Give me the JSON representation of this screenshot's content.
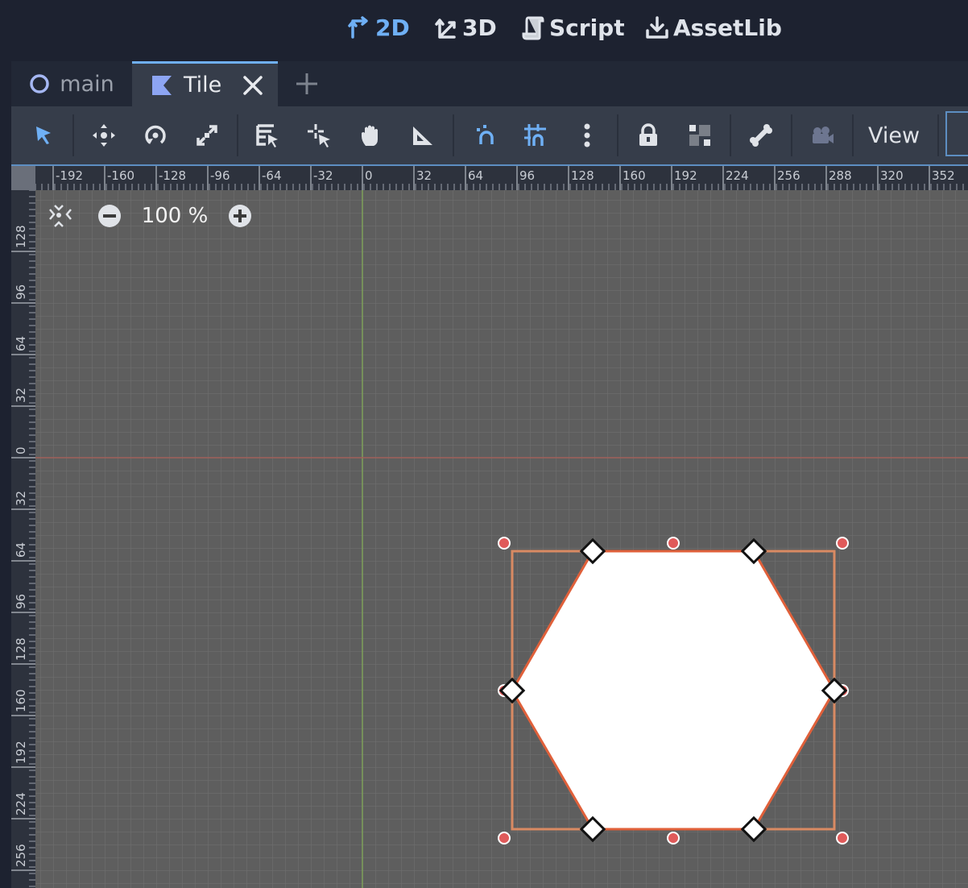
{
  "workspaces": [
    {
      "label": "2D",
      "icon": "2d-workspace-icon",
      "active": true
    },
    {
      "label": "3D",
      "icon": "3d-workspace-icon",
      "active": false
    },
    {
      "label": "Script",
      "icon": "script-workspace-icon",
      "active": false
    },
    {
      "label": "AssetLib",
      "icon": "assetlib-download-icon",
      "active": false
    }
  ],
  "tabs": [
    {
      "label": "main",
      "icon": "node2d-circle-icon",
      "active": false
    },
    {
      "label": "Tile",
      "icon": "tile-scene-icon",
      "active": true,
      "close_icon": "close-icon"
    }
  ],
  "new_tab_icon": "plus-icon",
  "toolbar": {
    "tools": [
      "select-arrow-icon",
      "move-icon",
      "rotate-icon",
      "scale-icon",
      "list-select-icon",
      "pivot-icon",
      "pan-hand-icon",
      "ruler-icon",
      "smart-snap-icon",
      "grid-snap-icon",
      "more-options-icon",
      "lock-icon",
      "group-icon",
      "skeleton-bone-icon",
      "camera-icon"
    ],
    "view_label": "View"
  },
  "viewport": {
    "zoom_label": "100 %",
    "zoom_out_icon": "zoom-out-icon",
    "zoom_in_icon": "zoom-in-icon",
    "center_icon": "center-view-icon",
    "ruler_top_labels": [
      "-192",
      "-160",
      "-128",
      "-96",
      "-64",
      "-32",
      "0",
      "32",
      "64",
      "96",
      "128",
      "160",
      "192",
      "224",
      "256",
      "288",
      "320",
      "352"
    ],
    "ruler_left_labels": [
      "128",
      "96",
      "64",
      "32",
      "0",
      "32",
      "64",
      "96",
      "128",
      "160",
      "192",
      "224",
      "256"
    ],
    "shape": "hexagon polygon",
    "colors": {
      "canvas": "#5c5c5c",
      "grid": "#6e6e6e",
      "polygon_fill": "#ffffff",
      "polygon_outline": "#e0603a",
      "rect_outline": "#d98a63",
      "handle_dot": "#e05a5a",
      "accent": "#6fb0f5"
    }
  }
}
